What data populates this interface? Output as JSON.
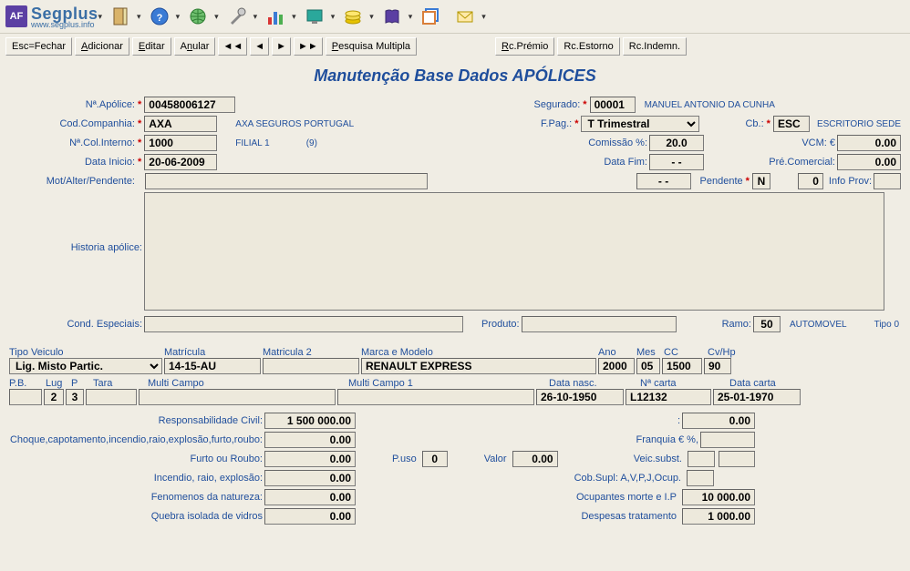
{
  "app": {
    "name": "Segplus",
    "subtitle": "www.segplus.info"
  },
  "toolbarIcons": [
    "door-icon",
    "help-icon",
    "globe-icon",
    "tools-icon",
    "chart-icon",
    "monitor-icon",
    "coins-icon",
    "book-icon",
    "windows-icon",
    "mail-icon"
  ],
  "toolbar2": {
    "esc": "Esc=Fechar",
    "add": "Adicionar",
    "edit": "Editar",
    "cancel": "Anular",
    "nav_first": "◄◄",
    "nav_prev": "◄",
    "nav_next": "►",
    "nav_last": "►►",
    "search": "Pesquisa Multipla",
    "rc_premio": "Rc.Prémio",
    "rc_estorno": "Rc.Estorno",
    "rc_indemn": "Rc.Indemn."
  },
  "title": "Manutenção Base Dados APÓLICES",
  "labels": {
    "apolice": "Nª.Apólice:",
    "companhia": "Cod.Companhia:",
    "colinterno": "Nª.Col.Interno:",
    "datainicio": "Data Inicio:",
    "motalter": "Mot/Alter/Pendente:",
    "historia": "Historia apólice:",
    "cond": "Cond. Especiais:",
    "segurado": "Segurado:",
    "fpag": "F.Pag.:",
    "comissao": "Comissão %:",
    "datafim": "Data Fim:",
    "pendente": "Pendente",
    "cb": "Cb.:",
    "vcm": "VCM: €",
    "precom": "Pré.Comercial:",
    "infoprov": "Info Prov:",
    "produto": "Produto:",
    "ramo": "Ramo:",
    "tipo": "Tipo  0"
  },
  "values": {
    "apolice": "00458006127",
    "companhia": "AXA",
    "companhia_desc": "AXA SEGUROS PORTUGAL",
    "colinterno": "1000",
    "colinterno_desc": "FILIAL 1",
    "colinterno_count": "(9)",
    "datainicio": "20-06-2009",
    "segurado": "00001",
    "segurado_nome": "MANUEL ANTONIO DA CUNHA",
    "fpag": "T Trimestral",
    "comissao": "20.0",
    "datafim": "- -",
    "datafim2": "- -",
    "pendente": "N",
    "pendente_num": "0",
    "cb": "ESC",
    "cb_desc": "ESCRITORIO SEDE",
    "vcm": "0.00",
    "precom": "0.00",
    "ramo": "50",
    "ramo_desc": "AUTOMOVEL"
  },
  "vehicle": {
    "labels": {
      "tipo": "Tipo Veiculo",
      "matricula": "Matrícula",
      "matricula2": "Matricula 2",
      "marca": "Marca e Modelo",
      "ano": "Ano",
      "mes": "Mes",
      "cc": "CC",
      "cvhp": "Cv/Hp",
      "pb": "P.B.",
      "lug": "Lug",
      "p": "P",
      "tara": "Tara",
      "multi": "Multi Campo",
      "multi1": "Multi Campo 1",
      "datanasc": "Data nasc.",
      "ncarta": "Nª carta",
      "datacarta": "Data carta"
    },
    "values": {
      "tipo": "Lig. Misto Partic.",
      "matricula": "14-15-AU",
      "marca": "RENAULT EXPRESS",
      "ano": "2000",
      "mes": "05",
      "cc": "1500",
      "cvhp": "90",
      "lug": "2",
      "p": "3",
      "datanasc": "26-10-1950",
      "ncarta": "L12132",
      "datacarta": "25-01-1970"
    }
  },
  "coverage": {
    "labels": {
      "resp": "Responsabilidade Civil:",
      "choque": "Choque,capotamento,incendio,raio,explosão,furto,roubo:",
      "furto": "Furto ou Roubo:",
      "incendio": "Incendio, raio, explosão:",
      "fenom": "Fenomenos da natureza:",
      "quebra": "Quebra isolada de vidros",
      "franquia": "Franquia € %,",
      "puso": "P.uso",
      "valor": "Valor",
      "veic": "Veic.subst.",
      "cobsupl": "Cob.Supl: A,V,P,J,Ocup.",
      "ocup": "Ocupantes morte e I.P",
      "desp": "Despesas tratamento",
      "colon": ":"
    },
    "values": {
      "resp": "1 500 000.00",
      "resp2": "0.00",
      "choque": "0.00",
      "furto": "0.00",
      "incendio": "0.00",
      "fenom": "0.00",
      "quebra": "0.00",
      "puso": "0",
      "valor": "0.00",
      "ocup": "10 000.00",
      "desp": "1 000.00"
    }
  }
}
